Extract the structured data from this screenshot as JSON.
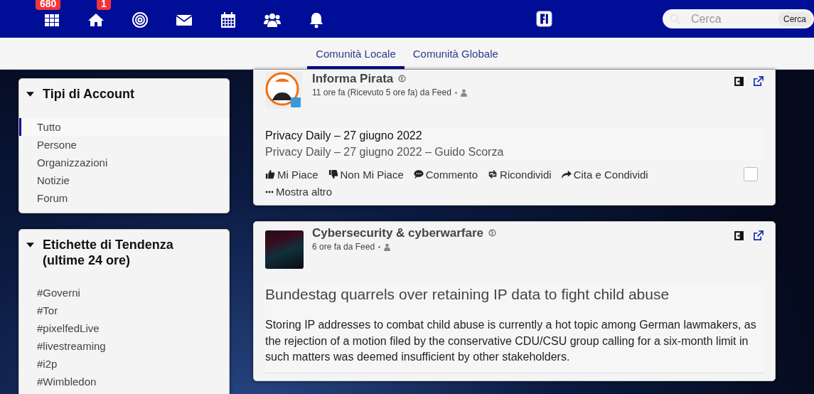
{
  "nav": {
    "icons": [
      {
        "kind": "grid",
        "badge": "680"
      },
      {
        "kind": "home",
        "badge": "1"
      },
      {
        "kind": "target"
      },
      {
        "kind": "mail"
      },
      {
        "kind": "calendar"
      },
      {
        "kind": "people"
      },
      {
        "kind": "bell"
      }
    ],
    "search": {
      "placeholder": "Cerca",
      "button": "Cerca"
    }
  },
  "tabs": [
    {
      "label": "Comunità Locale",
      "selected": true
    },
    {
      "label": "Comunità Globale",
      "selected": false
    }
  ],
  "account_types": {
    "title": "Tipi di Account",
    "expanded": true,
    "items": [
      {
        "label": "Tutto",
        "selected": true
      },
      {
        "label": "Persone",
        "selected": false
      },
      {
        "label": "Organizzazioni",
        "selected": false
      },
      {
        "label": "Notizie",
        "selected": false
      },
      {
        "label": "Forum",
        "selected": false
      }
    ]
  },
  "trending": {
    "title": "Etichette di Tendenza (ultime 24 ore)",
    "expanded": true,
    "tags": [
      "#Governi",
      "#Tor",
      "#pixelfedLive",
      "#livestreaming",
      "#i2p",
      "#Wimbledon"
    ]
  },
  "posts": [
    {
      "kind": "summary",
      "author": "Informa Pirata",
      "meta": "11 ore fa (Ricevuto 5 ore fa) da Feed",
      "title": "Privacy Daily – 27 giugno 2022",
      "body": "Privacy Daily – 27 giugno 2022 – Guido Scorza",
      "actions": [
        {
          "kind": "like",
          "label": "Mi Piace"
        },
        {
          "kind": "dislike",
          "label": "Non Mi Piace"
        },
        {
          "kind": "comment",
          "label": "Commento"
        },
        {
          "kind": "reshare",
          "label": "Ricondividi"
        },
        {
          "kind": "share",
          "label": "Cita e Condividi"
        }
      ],
      "more": "Mostra altro",
      "checked": false
    },
    {
      "kind": "article",
      "author": "Cybersecurity & cyberwarfare",
      "meta": "6 ore fa da Feed",
      "title": "Bundestag quarrels over retaining IP data to fight child abuse",
      "body": "Storing IP addresses to combat child abuse is currently a hot topic among German lawmakers, as the rejection of a motion filed by the conservative CDU/CSU group calling for a six-month limit in such matters was deemed insufficient by other stakeholders."
    }
  ]
}
